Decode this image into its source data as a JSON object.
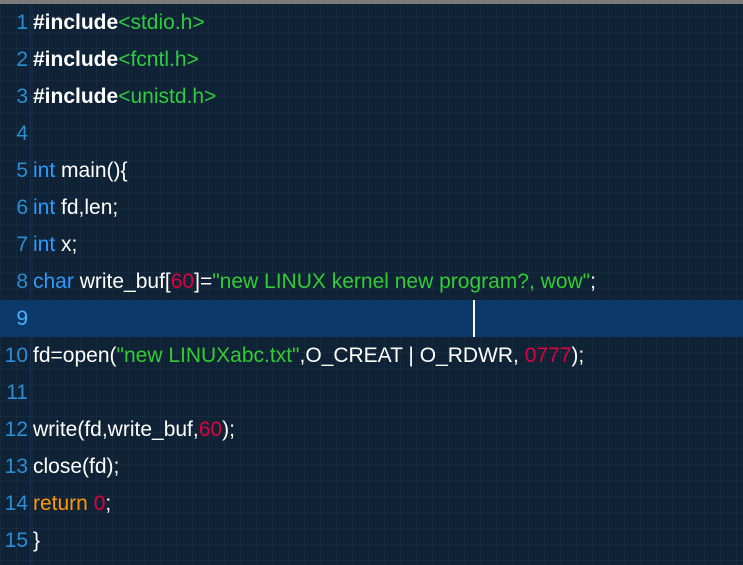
{
  "editor": {
    "lines": [
      {
        "n": "1",
        "t": [
          "#include",
          "<stdio.h>"
        ]
      },
      {
        "n": "2",
        "t": [
          "#include",
          "<fcntl.h>"
        ]
      },
      {
        "n": "3",
        "t": [
          "#include",
          "<unistd.h>"
        ]
      },
      {
        "n": "4",
        "t": []
      },
      {
        "n": "5",
        "t": [
          "int",
          " main(){"
        ]
      },
      {
        "n": "6",
        "t": [
          "int",
          " fd,len;"
        ]
      },
      {
        "n": "7",
        "t": [
          "int",
          " x;"
        ]
      },
      {
        "n": "8",
        "t": [
          "char",
          " write_buf[",
          "60",
          "]=",
          "\"new LINUX kernel new program?, wow\"",
          ";"
        ]
      },
      {
        "n": "9",
        "t": []
      },
      {
        "n": "10",
        "t": [
          "fd=open(",
          "\"new LINUXabc.txt\"",
          ",O_CREAT | O_RDWR, ",
          "0777",
          ");"
        ]
      },
      {
        "n": "11",
        "t": []
      },
      {
        "n": "12",
        "t": [
          "write(fd,write_buf,",
          "60",
          ");"
        ]
      },
      {
        "n": "13",
        "t": [
          "close(fd);"
        ]
      },
      {
        "n": "14",
        "t": [
          "return",
          " ",
          "0",
          ";"
        ]
      },
      {
        "n": "15",
        "t": [
          "}"
        ]
      }
    ]
  },
  "colors": {
    "background": "#0f2236",
    "current_line": "#0b3a6a",
    "line_number": "#2a8fd6",
    "keyword": "#2d9cff",
    "return_keyword": "#ff9900",
    "string": "#33cc33",
    "number": "#e0003c",
    "header": "#2ecc40"
  }
}
